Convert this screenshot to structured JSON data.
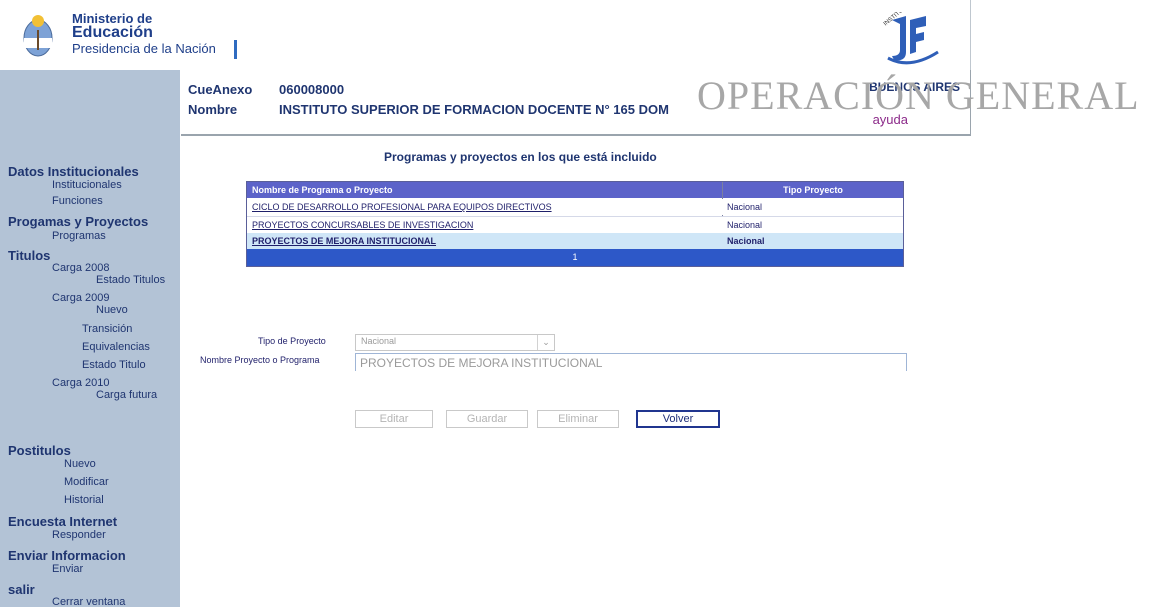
{
  "header": {
    "ministry_line1": "Ministerio de",
    "ministry_line2": "Educación",
    "ministry_line3": "Presidencia de la Nación"
  },
  "info": {
    "cueanexo_label": "CueAnexo",
    "cueanexo_value": "060008000",
    "nombre_label": "Nombre",
    "nombre_value": "INSTITUTO SUPERIOR DE FORMACION DOCENTE N° 165 DOM",
    "province": "BUENOS AIRES",
    "help_link": "ayuda",
    "watermark": "OPERACIÓN GENERAL"
  },
  "sidebar": {
    "datos_institucionales": "Datos Institucionales",
    "institucionales": "Institucionales",
    "funciones": "Funciones",
    "programas_proyectos": "Progamas y Proyectos",
    "programas": "Programas",
    "titulos": "Titulos",
    "carga_2008": "Carga 2008",
    "estado_titulos": "Estado Titulos",
    "carga_2009": "Carga 2009",
    "nuevo": "Nuevo",
    "transicion": "Transición",
    "equivalencias": "Equivalencias",
    "estado_titulo": "Estado Titulo",
    "carga_2010": "Carga 2010",
    "carga_futura": "Carga futura",
    "postitulos": "Postitulos",
    "post_nuevo": "Nuevo",
    "modificar": "Modificar",
    "historial": "Historial",
    "encuesta": "Encuesta Internet",
    "responder": "Responder",
    "enviar_info": "Enviar Informacion",
    "enviar": "Enviar",
    "salir": "salir",
    "cerrar": "Cerrar ventana"
  },
  "main": {
    "title": "Programas y proyectos en los que está incluido",
    "table": {
      "col1": "Nombre de Programa o Proyecto",
      "col2": "Tipo Proyecto",
      "rows": [
        {
          "name": "CICLO DE DESARROLLO PROFESIONAL PARA EQUIPOS DIRECTIVOS",
          "tipo": "Nacional"
        },
        {
          "name": "PROYECTOS CONCURSABLES DE INVESTIGACION",
          "tipo": "Nacional"
        },
        {
          "name": "PROYECTOS DE MEJORA INSTITUCIONAL",
          "tipo": "Nacional"
        }
      ],
      "pager": "1"
    },
    "form": {
      "tipo_label": "Tipo de Proyecto",
      "tipo_value": "Nacional",
      "nombre_label": "Nombre Proyecto o Programa",
      "nombre_value": "PROYECTOS DE MEJORA INSTITUCIONAL"
    },
    "buttons": {
      "editar": "Editar",
      "guardar": "Guardar",
      "eliminar": "Eliminar",
      "volver": "Volver"
    }
  },
  "colors": {
    "sidebar_bg": "#b3c3d6",
    "table_header": "#5c63c9",
    "pager": "#2d58c8",
    "selected_row": "#cfe6f7"
  }
}
